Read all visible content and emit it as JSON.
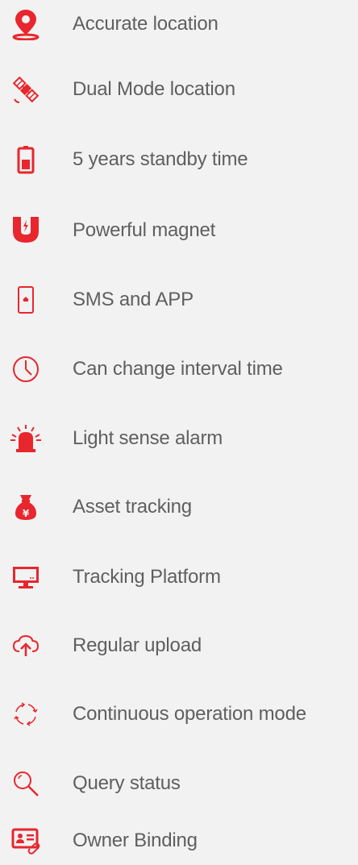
{
  "accent_color": "#e8262e",
  "features": [
    {
      "label": "Accurate location",
      "icon": "location-pin-icon"
    },
    {
      "label": "Dual Mode location",
      "icon": "satellite-icon"
    },
    {
      "label": "5 years standby time",
      "icon": "battery-icon"
    },
    {
      "label": "Powerful magnet",
      "icon": "magnet-icon"
    },
    {
      "label": "SMS and APP",
      "icon": "phone-icon"
    },
    {
      "label": "Can change interval time",
      "icon": "clock-icon"
    },
    {
      "label": "Light sense alarm",
      "icon": "alarm-light-icon"
    },
    {
      "label": "Asset tracking",
      "icon": "money-bag-icon"
    },
    {
      "label": "Tracking Platform",
      "icon": "monitor-icon"
    },
    {
      "label": "Regular upload",
      "icon": "cloud-upload-icon"
    },
    {
      "label": "Continuous operation mode",
      "icon": "refresh-icon"
    },
    {
      "label": "Query status",
      "icon": "search-icon"
    },
    {
      "label": "Owner Binding",
      "icon": "id-card-icon"
    }
  ]
}
